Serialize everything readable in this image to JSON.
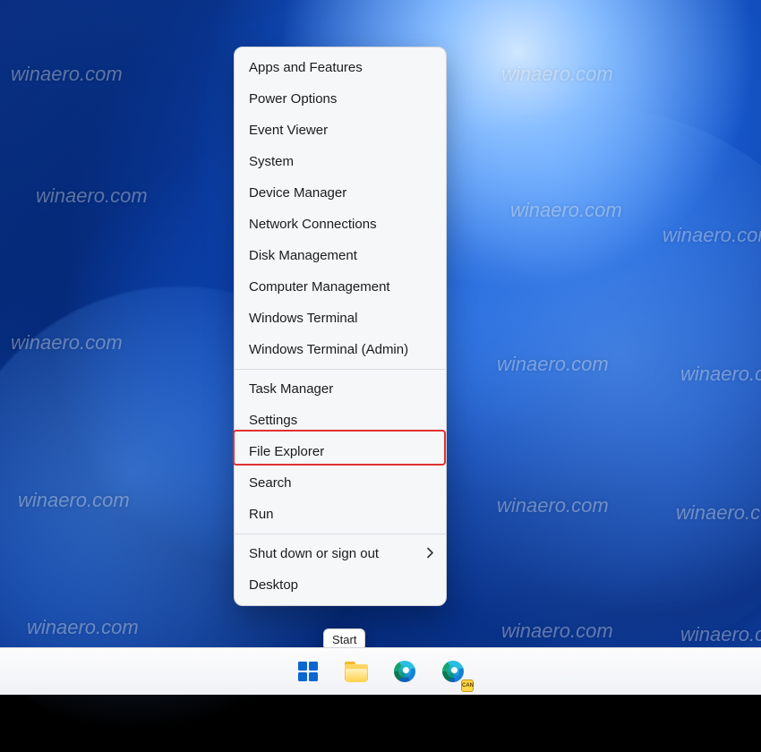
{
  "watermark": "winaero.com",
  "menu": {
    "group1": [
      "Apps and Features",
      "Power Options",
      "Event Viewer",
      "System",
      "Device Manager",
      "Network Connections",
      "Disk Management",
      "Computer Management",
      "Windows Terminal",
      "Windows Terminal (Admin)"
    ],
    "group2": [
      "Task Manager",
      "Settings",
      "File Explorer",
      "Search",
      "Run"
    ],
    "group3_submenu": "Shut down or sign out",
    "group3_last": "Desktop"
  },
  "highlighted_item": "Settings",
  "tooltip": "Start",
  "taskbar": {
    "start": "Start",
    "explorer": "File Explorer",
    "edge": "Microsoft Edge",
    "canary": "Microsoft Edge Canary",
    "canary_badge": "CAN"
  }
}
